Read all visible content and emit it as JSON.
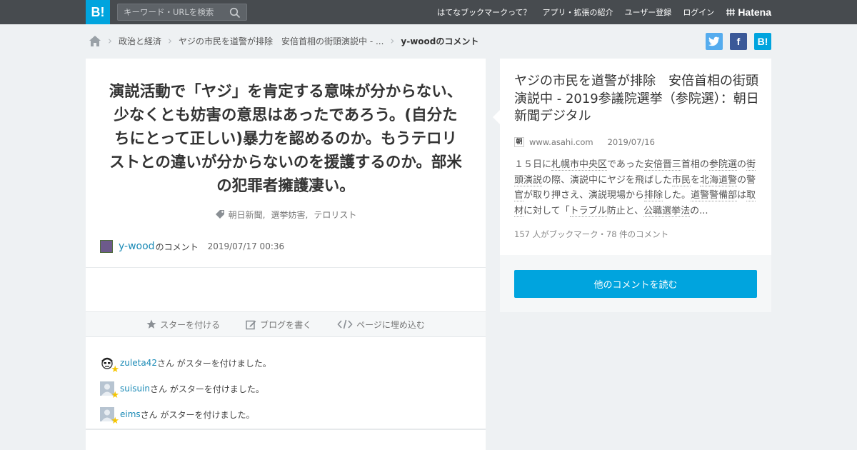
{
  "header": {
    "logo": "B!",
    "search_placeholder": "キーワード・URLを検索",
    "nav": [
      "はてなブックマークって？",
      "アプリ・拡張の紹介",
      "ユーザー登録",
      "ログイン"
    ],
    "brand": "Hatena"
  },
  "breadcrumb": {
    "items": [
      "政治と経済",
      "ヤジの市民を道警が排除　安倍首相の街頭演説中 - ..."
    ],
    "current": "y-woodのコメント"
  },
  "share": {
    "twitter": "twitter-icon",
    "facebook": "f",
    "hatena": "B!"
  },
  "comment": {
    "text": "演説活動で「ヤジ」を肯定する意味が分からない、少なくとも妨害の意思はあったであろう。(自分たちにとって正しい)暴力を認めるのか。もうテロリストとの違いが分からないのを援護するのか。部米の犯罪者擁護凄い。",
    "tags": [
      "朝日新聞",
      "選挙妨害",
      "テロリスト"
    ],
    "user": "y-wood",
    "user_suffix": "のコメント",
    "date": "2019/07/17 00:36"
  },
  "actions": {
    "star": "スターを付ける",
    "blog": "ブログを書く",
    "embed": "ページに埋め込む"
  },
  "stars": [
    {
      "name": "zuleta42",
      "text": "さん がスターを付けました。"
    },
    {
      "name": "suisuin",
      "text": "さん がスターを付けました。"
    },
    {
      "name": "eims",
      "text": "さん がスターを付けました。"
    }
  ],
  "entry": {
    "title": "ヤジの市民を道警が排除　安倍首相の街頭演説中 - 2019参議院選挙（参院選）：朝日新聞デジタル",
    "favicon": "朝",
    "site": "www.asahi.com",
    "date": "2019/07/16",
    "summary_parts": [
      {
        "t": "１５日に",
        "k": false
      },
      {
        "t": "札幌市中央区",
        "k": true
      },
      {
        "t": "であった",
        "k": false
      },
      {
        "t": "安倍晋三",
        "k": true
      },
      {
        "t": "首相の",
        "k": false
      },
      {
        "t": "参院選",
        "k": true
      },
      {
        "t": "の",
        "k": false
      },
      {
        "t": "街頭演説",
        "k": true
      },
      {
        "t": "の際、演説中にヤジを飛ばした",
        "k": false
      },
      {
        "t": "市民",
        "k": true
      },
      {
        "t": "を",
        "k": false
      },
      {
        "t": "北海道警",
        "k": true
      },
      {
        "t": "の警",
        "k": false
      },
      {
        "t": "官",
        "k": true
      },
      {
        "t": "が取り押さえ、演説現場から",
        "k": false
      },
      {
        "t": "排除",
        "k": true
      },
      {
        "t": "した。",
        "k": false
      },
      {
        "t": "道警警備部",
        "k": true
      },
      {
        "t": "は",
        "k": false
      },
      {
        "t": "取材",
        "k": true
      },
      {
        "t": "に対して「",
        "k": false
      },
      {
        "t": "トラブル",
        "k": true
      },
      {
        "t": "防止と、",
        "k": false
      },
      {
        "t": "公職選挙法",
        "k": true
      },
      {
        "t": "の...",
        "k": false
      }
    ],
    "counts": "157 人がブックマーク・78 件のコメント",
    "more_button": "他のコメントを読む"
  },
  "colors": {
    "brand": "#00a4de",
    "header": "#474b4f",
    "link": "#1a8ab6",
    "star": "#f5c500"
  }
}
